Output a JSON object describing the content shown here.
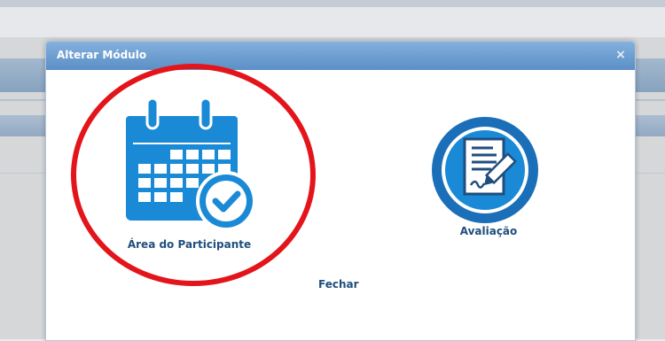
{
  "dialog": {
    "title": "Alterar Módulo",
    "close_symbol": "×",
    "modules": [
      {
        "label": "Área do Participante",
        "icon": "calendar-check-icon"
      },
      {
        "label": "Avaliação",
        "icon": "signed-document-icon"
      }
    ],
    "close_label": "Fechar"
  },
  "colors": {
    "titlebar": "#6f9fd0",
    "icon_blue": "#1a8ad6",
    "label_text": "#1f4e7e",
    "highlight_circle": "#e4141b"
  }
}
